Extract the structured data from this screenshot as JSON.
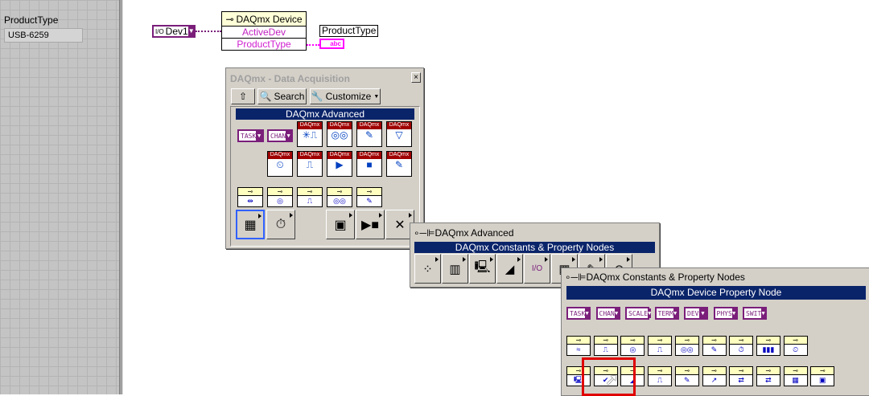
{
  "front_panel": {
    "indicator_label": "ProductType",
    "indicator_value": "USB-6259"
  },
  "diagram": {
    "constant_value": "Dev1",
    "constant_prefix": "I/O",
    "property_node": {
      "title": "DAQmx Device",
      "rows": [
        "ActiveDev",
        "ProductType"
      ]
    },
    "output_label": "ProductType",
    "output_terminal": "abc"
  },
  "palette1": {
    "title": "DAQmx - Data Acquisition",
    "close": "×",
    "up_label": "⇧",
    "search_label": "Search",
    "customize_label": "Customize",
    "banner": "DAQmx Advanced",
    "constants": [
      "TASK",
      "CHAN"
    ],
    "daqmx_tag": "DAQmx",
    "row1_icons": [
      "create-virtual-channel",
      "read",
      "write",
      "trigger"
    ],
    "row1_glyphs": [
      "✳⎍",
      "◎◎",
      "✎",
      "▽"
    ],
    "row2_icons": [
      "timing",
      "start",
      "stop",
      "clear",
      "write-property"
    ],
    "row2_glyphs": [
      "⏲",
      "⎍",
      "▶",
      "■",
      "✎"
    ],
    "row3_glyphs": [
      "⇹",
      "◎",
      "⎍",
      "◎◎",
      "✎"
    ],
    "row4_glyphs": [
      "▦",
      "⏱",
      "▣",
      "▶■",
      "✕"
    ]
  },
  "palette2": {
    "title": "DAQmx Advanced",
    "banner": "DAQmx Constants & Property Nodes",
    "glyphs": [
      "⁘",
      "▥",
      "🖳",
      "◢",
      "I/O",
      "▦",
      "✎",
      "⊗"
    ]
  },
  "palette3": {
    "title": "DAQmx Constants & Property Nodes",
    "banner": "DAQmx Device Property Node",
    "constants": [
      "TASK",
      "CHAN",
      "SCALE",
      "TERM",
      "DEV",
      "PHYS",
      "SWIT"
    ],
    "rowA": [
      "≈",
      "⎍",
      "◎",
      "⎍",
      "◎◎",
      "✎",
      "⏱",
      "▮▮▮",
      "⏲"
    ],
    "rowB": [
      "🖳",
      "✔",
      "◢",
      "⎍",
      "✎",
      "↗",
      "⇄",
      "⇄",
      "▦",
      "▣"
    ]
  }
}
